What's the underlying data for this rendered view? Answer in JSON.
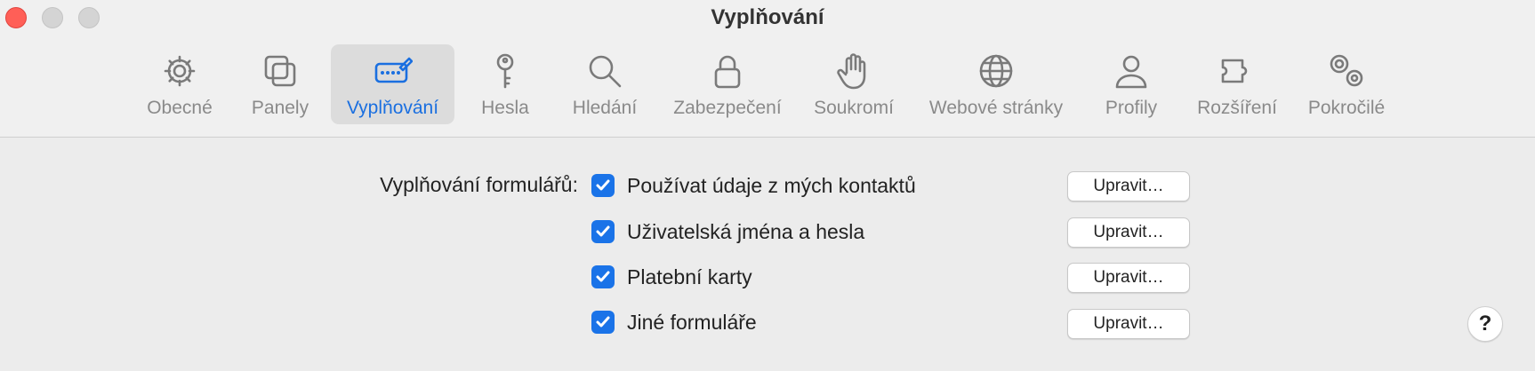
{
  "window": {
    "title": "Vyplňování"
  },
  "tabs": [
    {
      "label": "Obecné",
      "icon": "gear-icon"
    },
    {
      "label": "Panely",
      "icon": "tabs-icon"
    },
    {
      "label": "Vyplňování",
      "icon": "autofill-icon",
      "active": true
    },
    {
      "label": "Hesla",
      "icon": "key-icon"
    },
    {
      "label": "Hledání",
      "icon": "magnifier-icon"
    },
    {
      "label": "Zabezpečení",
      "icon": "lock-icon"
    },
    {
      "label": "Soukromí",
      "icon": "hand-icon"
    },
    {
      "label": "Webové stránky",
      "icon": "globe-icon"
    },
    {
      "label": "Profily",
      "icon": "person-icon"
    },
    {
      "label": "Rozšíření",
      "icon": "puzzle-icon"
    },
    {
      "label": "Pokročilé",
      "icon": "gears-icon"
    }
  ],
  "autofill": {
    "section_label": "Vyplňování formulářů:",
    "options": [
      {
        "label": "Používat údaje z mých kontaktů",
        "checked": true,
        "button": "Upravit…"
      },
      {
        "label": "Uživatelská jména a hesla",
        "checked": true,
        "button": "Upravit…"
      },
      {
        "label": "Platební karty",
        "checked": true,
        "button": "Upravit…"
      },
      {
        "label": "Jiné formuláře",
        "checked": true,
        "button": "Upravit…"
      }
    ]
  },
  "help": {
    "label": "?"
  },
  "colors": {
    "accent": "#1a6fe0",
    "checkbox": "#1a73e8",
    "close": "#ff5f57"
  }
}
